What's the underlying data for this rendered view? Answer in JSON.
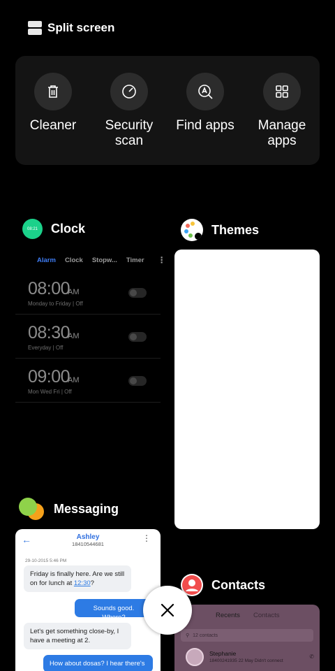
{
  "split_screen": {
    "label": "Split screen"
  },
  "quick_actions": [
    {
      "label": "Cleaner",
      "icon": "trash-icon"
    },
    {
      "label": "Security scan",
      "icon": "gauge-icon"
    },
    {
      "label": "Find apps",
      "icon": "search-app-icon"
    },
    {
      "label": "Manage apps",
      "icon": "grid-icon"
    }
  ],
  "clock": {
    "title": "Clock",
    "icon_time": "08:21",
    "tabs": [
      "Alarm",
      "Clock",
      "Stopw...",
      "Timer"
    ],
    "alarms": [
      {
        "time": "08:00",
        "ampm": "AM",
        "days": "Monday to Friday  |  Off"
      },
      {
        "time": "08:30",
        "ampm": "AM",
        "days": "Everyday  |  Off"
      },
      {
        "time": "09:00",
        "ampm": "AM",
        "days": "Mon Wed Fri  |  Off"
      }
    ]
  },
  "themes": {
    "title": "Themes"
  },
  "messaging": {
    "title": "Messaging",
    "contact_name": "Ashley",
    "contact_number": "18410544681",
    "date": "29-10-2015 5:46 PM",
    "msg1_text": "Friday is finally here. Are we still on for lunch at ",
    "msg1_link": "12:30",
    "msg1_end": "?",
    "msg2": "Sounds good. Where?",
    "msg3": "Let's get something close-by, I have a meeting at 2.",
    "msg4": "How about dosas? I hear there's"
  },
  "contacts": {
    "title": "Contacts",
    "tabs": [
      "Recents",
      "Contacts"
    ],
    "search": "12 contacts",
    "entry_name": "Stephanie",
    "entry_detail": "18400241935  22 May Didn't connect"
  },
  "colors": {
    "accent_blue": "#3f7df5",
    "clock_green": "#1bd18a",
    "bubble_blue": "#2d7be4"
  }
}
